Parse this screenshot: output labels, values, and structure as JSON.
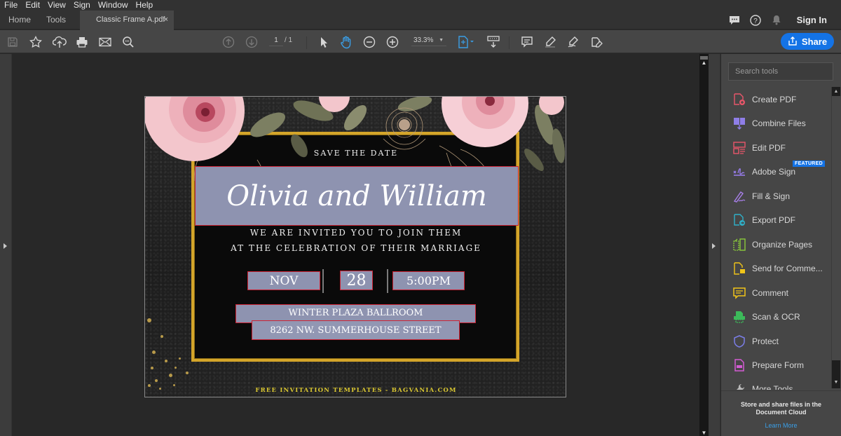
{
  "menu": [
    "File",
    "Edit",
    "View",
    "Sign",
    "Window",
    "Help"
  ],
  "tabs": {
    "home": "Home",
    "tools": "Tools",
    "document": "Classic Frame A.pdf",
    "close_glyph": "×"
  },
  "header": {
    "sign_in": "Sign In",
    "share": "Share"
  },
  "toolbar": {
    "page_current": "1",
    "page_total": "/ 1",
    "zoom_level": "33.3%"
  },
  "tools_panel": {
    "search_placeholder": "Search tools",
    "items": [
      {
        "label": "Create PDF",
        "icon": "create-pdf-icon",
        "color": "#e8566a"
      },
      {
        "label": "Combine Files",
        "icon": "combine-files-icon",
        "color": "#8f7ee8"
      },
      {
        "label": "Edit PDF",
        "icon": "edit-pdf-icon",
        "color": "#e8566a"
      },
      {
        "label": "Adobe Sign",
        "icon": "adobe-sign-icon",
        "color": "#9a7ef0",
        "badge": "FEATURED"
      },
      {
        "label": "Fill & Sign",
        "icon": "fill-sign-icon",
        "color": "#a77fe8"
      },
      {
        "label": "Export PDF",
        "icon": "export-pdf-icon",
        "color": "#2fb0c8"
      },
      {
        "label": "Organize Pages",
        "icon": "organize-pages-icon",
        "color": "#8ac93a"
      },
      {
        "label": "Send for Comme...",
        "icon": "send-for-comment-icon",
        "color": "#f0c419"
      },
      {
        "label": "Comment",
        "icon": "comment-icon",
        "color": "#f0c419"
      },
      {
        "label": "Scan & OCR",
        "icon": "scan-ocr-icon",
        "color": "#3cba5a"
      },
      {
        "label": "Protect",
        "icon": "protect-icon",
        "color": "#7b7ee8"
      },
      {
        "label": "Prepare Form",
        "icon": "prepare-form-icon",
        "color": "#d35bd3"
      },
      {
        "label": "More Tools",
        "icon": "more-tools-icon",
        "color": "#bbbbbb"
      }
    ],
    "cloud_text": "Store and share files in the Document Cloud",
    "learn_more": "Learn More"
  },
  "document": {
    "save_the_date": "SAVE THE DATE",
    "names": "Olivia and William",
    "invite_line1": "WE ARE INVITED YOU TO JOIN THEM",
    "invite_line2": "AT THE CELEBRATION OF THEIR MARRIAGE",
    "month": "NOV",
    "day": "28",
    "time": "5:00PM",
    "venue": "WINTER PLAZA BALLROOM",
    "address": "8262 NW. SUMMERHOUSE STREET",
    "footer": "FREE INVITATION TEMPLATES - BAGVANIA.COM"
  },
  "colors": {
    "accent": "#1473e6",
    "field_fill": "#8e93b0",
    "field_border": "#cc2233",
    "frame_gold": "#d4a52a"
  }
}
